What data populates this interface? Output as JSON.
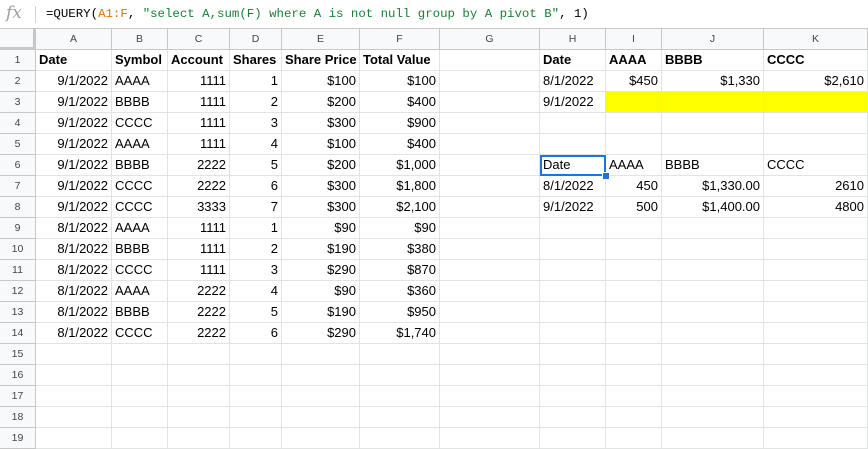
{
  "formula_bar": {
    "fx_icon": "fx-icon",
    "parts": [
      {
        "text": "=QUERY(",
        "kind": "plain"
      },
      {
        "text": "A1:F",
        "kind": "ref"
      },
      {
        "text": ", ",
        "kind": "plain"
      },
      {
        "text": "\"select A,sum(F) where A is not null group by A pivot B\"",
        "kind": "str"
      },
      {
        "text": ", 1)",
        "kind": "plain"
      }
    ]
  },
  "columns": [
    "A",
    "B",
    "C",
    "D",
    "E",
    "F",
    "G",
    "H",
    "I",
    "J",
    "K"
  ],
  "rows": [
    "1",
    "2",
    "3",
    "4",
    "5",
    "6",
    "7",
    "8",
    "9",
    "10",
    "11",
    "12",
    "13",
    "14",
    "15",
    "16",
    "17",
    "18",
    "19"
  ],
  "sheet": {
    "A": [
      "Date",
      "9/1/2022",
      "9/1/2022",
      "9/1/2022",
      "9/1/2022",
      "9/1/2022",
      "9/1/2022",
      "9/1/2022",
      "8/1/2022",
      "8/1/2022",
      "8/1/2022",
      "8/1/2022",
      "8/1/2022",
      "8/1/2022"
    ],
    "B": [
      "Symbol",
      "AAAA",
      "BBBB",
      "CCCC",
      "AAAA",
      "BBBB",
      "CCCC",
      "CCCC",
      "AAAA",
      "BBBB",
      "CCCC",
      "AAAA",
      "BBBB",
      "CCCC"
    ],
    "C": [
      "Account",
      "1111",
      "1111",
      "1111",
      "1111",
      "2222",
      "2222",
      "3333",
      "1111",
      "1111",
      "1111",
      "2222",
      "2222",
      "2222"
    ],
    "D": [
      "Shares",
      "1",
      "2",
      "3",
      "4",
      "5",
      "6",
      "7",
      "1",
      "2",
      "3",
      "4",
      "5",
      "6"
    ],
    "E": [
      "Share Price",
      "$100",
      "$200",
      "$300",
      "$100",
      "$200",
      "$300",
      "$300",
      "$90",
      "$190",
      "$290",
      "$90",
      "$190",
      "$290"
    ],
    "F": [
      "Total Value",
      "$100",
      "$400",
      "$900",
      "$400",
      "$1,000",
      "$1,800",
      "$2,100",
      "$90",
      "$380",
      "$870",
      "$360",
      "$950",
      "$1,740"
    ]
  },
  "pivot_top": {
    "header": [
      "Date",
      "AAAA",
      "BBBB",
      "CCCC"
    ],
    "row1": [
      "8/1/2022",
      "$450",
      "$1,330",
      "$2,610"
    ],
    "row2": [
      "9/1/2022",
      "",
      "",
      ""
    ]
  },
  "pivot_bottom": {
    "header": [
      "Date",
      "AAAA",
      "BBBB",
      "CCCC"
    ],
    "row1": [
      "8/1/2022",
      "450",
      "$1,330.00",
      "2610"
    ],
    "row2": [
      "9/1/2022",
      "500",
      "$1,400.00",
      "4800"
    ]
  },
  "colors": {
    "highlight": "#ffff00",
    "selection": "#1a73e8"
  }
}
